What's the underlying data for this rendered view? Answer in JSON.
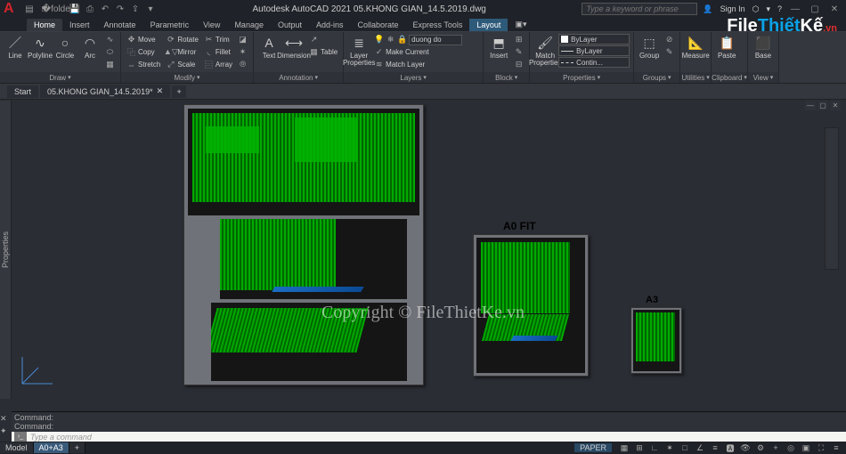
{
  "titlebar": {
    "app_title": "Autodesk AutoCAD 2021   05.KHONG GIAN_14.5.2019.dwg",
    "search_placeholder": "Type a keyword or phrase",
    "sign_in": "Sign In"
  },
  "ribbon_tabs": [
    "Home",
    "Insert",
    "Annotate",
    "Parametric",
    "View",
    "Manage",
    "Output",
    "Add-ins",
    "Collaborate",
    "Express Tools",
    "Layout"
  ],
  "ribbon_active": 0,
  "ribbon": {
    "draw": {
      "label": "Draw",
      "line": "Line",
      "polyline": "Polyline",
      "circle": "Circle",
      "arc": "Arc"
    },
    "modify": {
      "label": "Modify",
      "move": "Move",
      "rotate": "Rotate",
      "trim": "Trim",
      "copy": "Copy",
      "mirror": "Mirror",
      "fillet": "Fillet",
      "stretch": "Stretch",
      "scale": "Scale",
      "array": "Array"
    },
    "annotation": {
      "label": "Annotation",
      "text": "Text",
      "dimension": "Dimension",
      "table": "Table"
    },
    "layers": {
      "label": "Layers",
      "props": "Layer\nProperties",
      "current": "duong do",
      "makecurrent": "Make Current",
      "matchlayer": "Match Layer"
    },
    "block": {
      "label": "Block",
      "insert": "Insert"
    },
    "properties": {
      "label": "Properties",
      "match": "Match\nProperties",
      "bylayer": "ByLayer",
      "bylayer2": "ByLayer",
      "contin": "Contin..."
    },
    "groups": {
      "label": "Groups",
      "group": "Group"
    },
    "utilities": {
      "label": "Utilities",
      "measure": "Measure"
    },
    "clipboard": {
      "label": "Clipboard",
      "paste": "Paste"
    },
    "view": {
      "label": "View",
      "base": "Base"
    }
  },
  "filetabs": {
    "start": "Start",
    "file": "05.KHONG GIAN_14.5.2019*",
    "add": "+"
  },
  "sidebar": {
    "properties": "Properties"
  },
  "canvas": {
    "label_a0": "A0 FIT",
    "label_a3": "A3"
  },
  "copyright": "Copyright © FileThietKe.vn",
  "cmd": {
    "history": "Command:\nCommand:",
    "prompt_text": "Type a command"
  },
  "status": {
    "model": "Model",
    "layout": "A0+A3",
    "paper": "PAPER",
    "menu": "≡"
  },
  "watermark": {
    "p1": "File",
    "p2": "Thiết",
    "p3": "Kế",
    "p4": ".vn"
  }
}
